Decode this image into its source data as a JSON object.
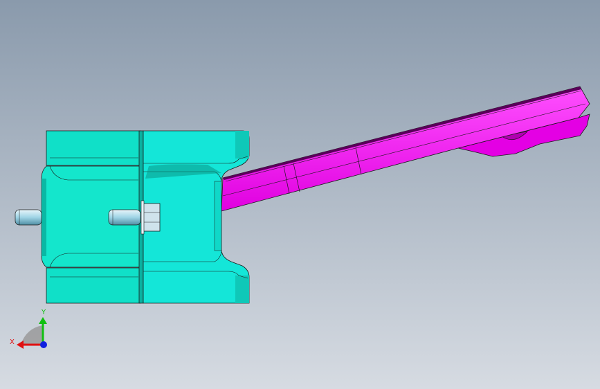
{
  "viewport": {
    "background_top": "#8a9aac",
    "background_bottom": "#d6dbe2"
  },
  "model": {
    "block_color": "#0fe3c8",
    "block_color_light": "#20f0dc",
    "block_color_dark": "#0ab0a0",
    "arm_color": "#f000f0",
    "arm_color_light": "#ff40ff",
    "arm_color_dark": "#b000b0",
    "pin_color": "#9fd4e6",
    "nut_color": "#c8dfe8",
    "edge_color": "#1a1a1a"
  },
  "triad": {
    "x_label": "X",
    "y_label": "Y",
    "x_color": "#e01010",
    "y_color": "#10c010",
    "z_color": "#1020e0"
  }
}
